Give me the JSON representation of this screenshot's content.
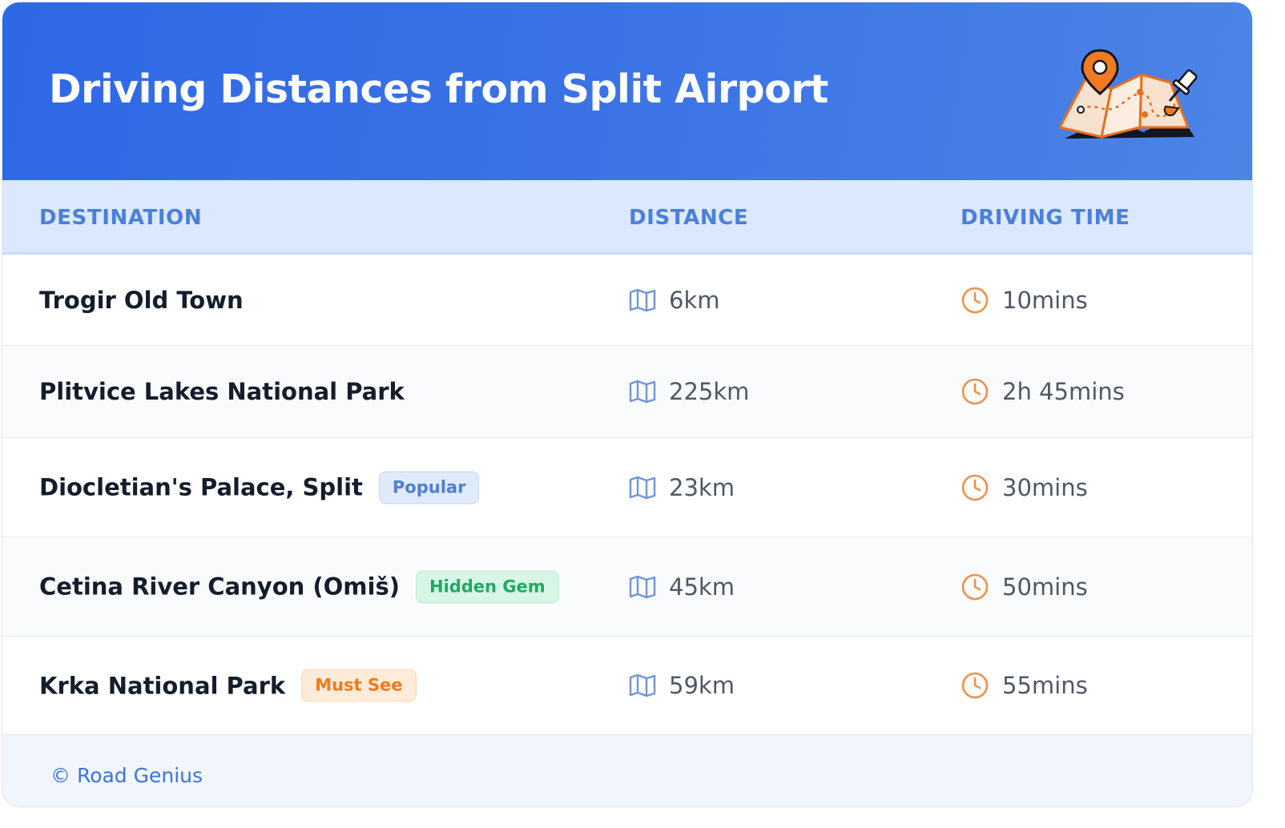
{
  "header": {
    "title": "Driving Distances from Split Airport",
    "illustration": "map-with-pins-icon"
  },
  "table": {
    "columns": [
      "DESTINATION",
      "DISTANCE",
      "DRIVING TIME"
    ],
    "distance_icon": "map-icon",
    "time_icon": "clock-icon",
    "rows": [
      {
        "destination": "Trogir Old Town",
        "badge": null,
        "distance": "6km",
        "time": "10mins"
      },
      {
        "destination": "Plitvice Lakes National Park",
        "badge": null,
        "distance": "225km",
        "time": "2h 45mins"
      },
      {
        "destination": "Diocletian's Palace, Split",
        "badge": "Popular",
        "badge_color": "#4e7fd6",
        "distance": "23km",
        "time": "30mins"
      },
      {
        "destination": "Cetina River Canyon (Omiš)",
        "badge": "Hidden Gem",
        "badge_color": "#1fa965",
        "distance": "45km",
        "time": "50mins"
      },
      {
        "destination": "Krka National Park",
        "badge": "Must See",
        "badge_color": "#ee7a1c",
        "distance": "59km",
        "time": "55mins"
      }
    ]
  },
  "footer": {
    "copyright": "© Road Genius"
  },
  "colors": {
    "header_start": "#2e68e6",
    "header_end": "#4d84e6",
    "table_header_bg": "#dbe8fd",
    "column_header_text": "#4a7fda",
    "map_icon": "#6f95d8",
    "clock_icon": "#f0904a"
  }
}
